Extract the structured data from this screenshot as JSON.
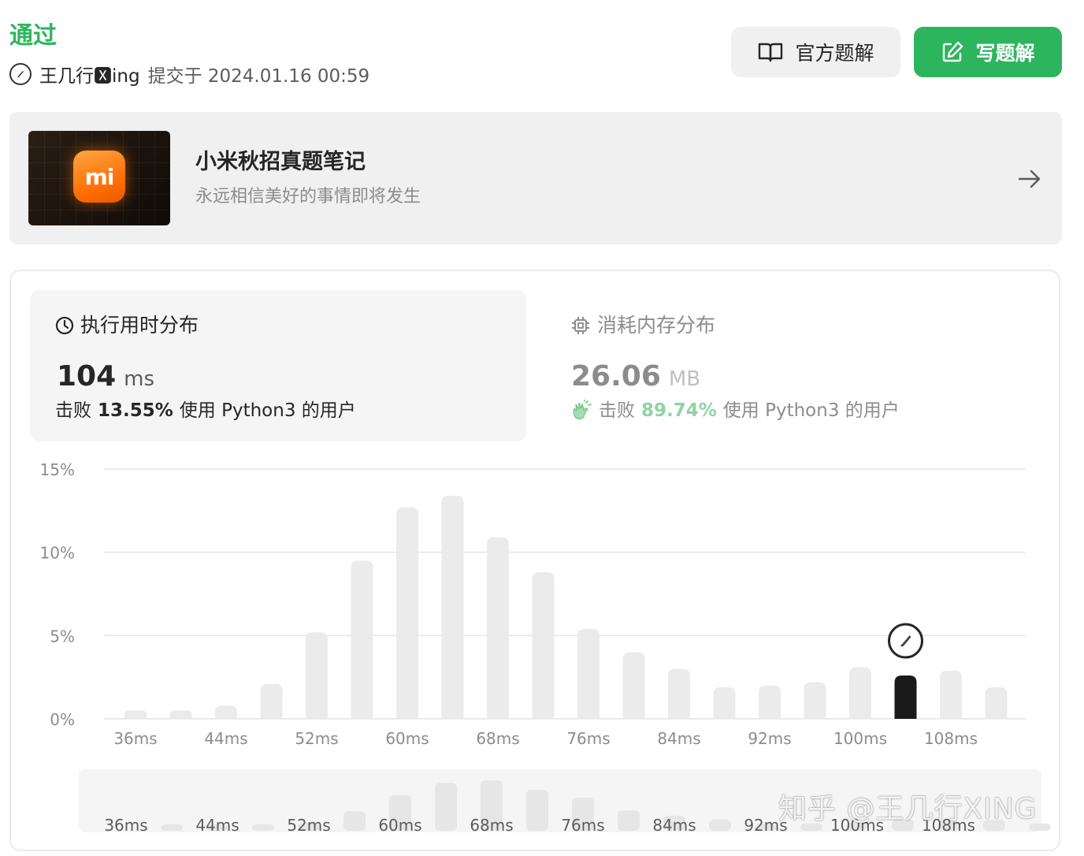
{
  "header": {
    "status": "通过",
    "username": "王几行🆇ing",
    "submitted_at": "提交于 2024.01.16 00:59",
    "official_solution_label": "官方题解",
    "write_solution_label": "写题解"
  },
  "banner": {
    "logo_text": "mi",
    "title": "小米秋招真题笔记",
    "subtitle": "永远相信美好的事情即将发生"
  },
  "stats": {
    "runtime": {
      "title": "执行用时分布",
      "value": "104",
      "unit": "ms",
      "beat_prefix": "击败",
      "beat_pct": "13.55%",
      "beat_suffix": "使用 Python3 的用户"
    },
    "memory": {
      "title": "消耗内存分布",
      "value": "26.06",
      "unit": "MB",
      "beat_prefix": "击败",
      "beat_pct": "89.74%",
      "beat_suffix": "使用 Python3 的用户"
    }
  },
  "colors": {
    "accent_green": "#2db55d",
    "bar": "#ebebeb",
    "bar_highlight": "#1a1a1a",
    "light_green": "#8fd3a3"
  },
  "chart_data": {
    "type": "bar",
    "x": [
      36,
      40,
      44,
      48,
      52,
      56,
      60,
      64,
      68,
      72,
      76,
      80,
      84,
      88,
      92,
      96,
      100,
      104,
      108,
      112
    ],
    "values": [
      0.5,
      0.5,
      0.8,
      2.1,
      5.2,
      9.5,
      12.7,
      13.4,
      10.9,
      8.8,
      5.4,
      4.0,
      3.0,
      1.9,
      2.0,
      2.2,
      3.1,
      2.6,
      2.9,
      1.9
    ],
    "highlight_x": 104,
    "y_ticks": [
      "0%",
      "5%",
      "10%",
      "15%"
    ],
    "x_tick_labels": [
      "36ms",
      "44ms",
      "52ms",
      "60ms",
      "68ms",
      "76ms",
      "84ms",
      "92ms",
      "100ms",
      "108ms"
    ],
    "ylim": [
      0,
      15
    ],
    "grid": true,
    "navigator": {
      "x_tick_labels": [
        "36ms",
        "44ms",
        "52ms",
        "60ms",
        "68ms",
        "76ms",
        "84ms",
        "92ms",
        "100ms",
        "108ms"
      ]
    }
  },
  "watermark": "知乎 @王几行XING"
}
